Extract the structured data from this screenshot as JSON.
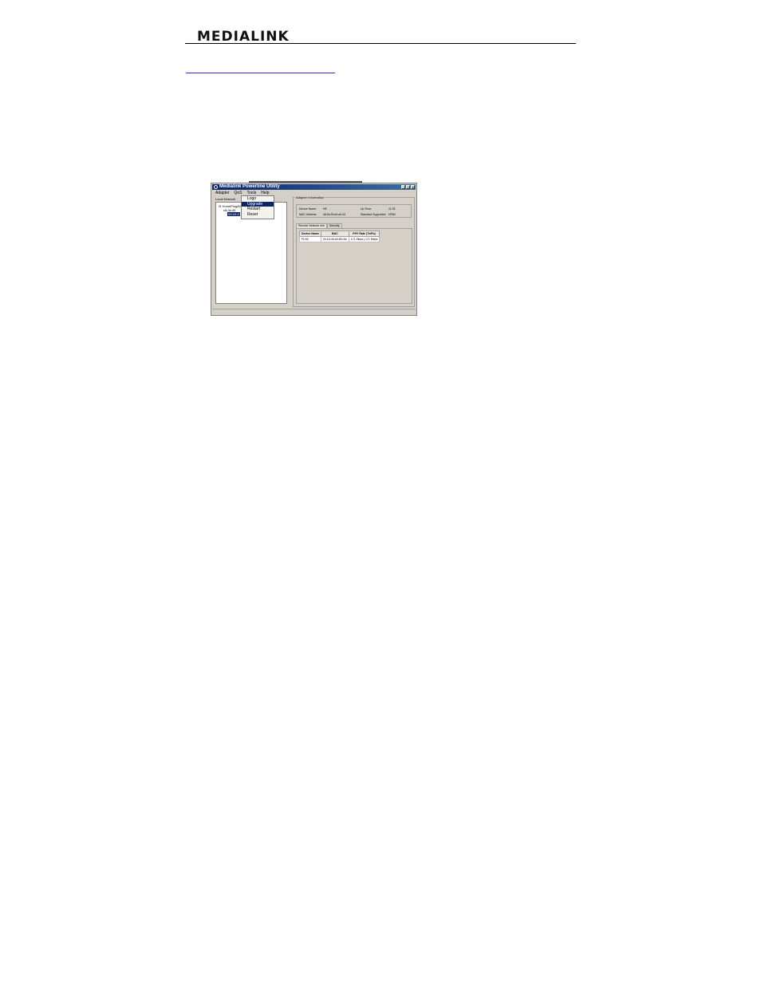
{
  "header": {
    "brand": "MEDIALINK"
  },
  "app": {
    "title": "Medialink Powerline Utility",
    "menu": [
      "Adapter",
      "QoS",
      "Tools",
      "Help"
    ],
    "tools_menu": [
      "Logo",
      "Upgrade",
      "Restart",
      "Reset"
    ],
    "tools_menu_active_index": 1,
    "local_network": {
      "label": "Local Network",
      "tree": [
        "HomePlugAV",
        "c8:3a:35",
        "00:1E:C"
      ]
    },
    "adapter_info": {
      "label": "Adapter Information",
      "device_name_label": "Device Name:",
      "device_name": "HE",
      "up_time_label": "Up Time:",
      "up_time": "11:33",
      "mac_label": "MAC Address:",
      "mac": "c8:3a:35:a0:a0:42",
      "standard_label": "Standard Supported:",
      "standard": "HPAV"
    },
    "tabs": [
      "Remote Network Info",
      "Security"
    ],
    "table": {
      "headers": [
        "Device Name",
        "MAC",
        "PHY Rate (Tx/Rx)"
      ],
      "rows": [
        [
          "PLN0",
          "00:1A:35:A0:8D:4A",
          "171 Mbps | 171 Mbps"
        ]
      ]
    }
  }
}
